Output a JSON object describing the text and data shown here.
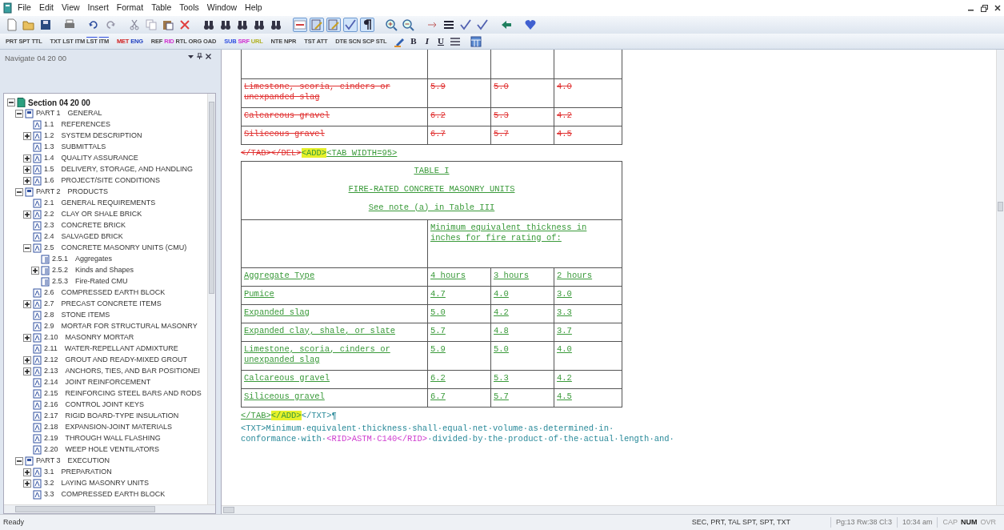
{
  "menu": [
    "File",
    "Edit",
    "View",
    "Insert",
    "Format",
    "Table",
    "Tools",
    "Window",
    "Help"
  ],
  "toolbar": [
    [
      {
        "kind": "new",
        "pressed": false
      },
      {
        "kind": "open",
        "pressed": false
      },
      {
        "kind": "save",
        "pressed": false
      }
    ],
    [
      {
        "kind": "print",
        "pressed": false
      }
    ],
    [
      {
        "kind": "undo",
        "pressed": false
      },
      {
        "kind": "redo",
        "pressed": false
      }
    ],
    [
      {
        "kind": "cut",
        "pressed": false
      },
      {
        "kind": "copy",
        "pressed": false
      },
      {
        "kind": "paste",
        "pressed": false
      },
      {
        "kind": "delete",
        "pressed": false
      }
    ],
    [
      {
        "kind": "find",
        "pressed": false
      },
      {
        "kind": "find",
        "pressed": false
      },
      {
        "kind": "find",
        "pressed": false
      },
      {
        "kind": "find",
        "pressed": false
      },
      {
        "kind": "find",
        "pressed": false
      }
    ],
    [
      {
        "kind": "tags",
        "pressed": true
      },
      {
        "kind": "view",
        "pressed": true
      },
      {
        "kind": "view",
        "pressed": true
      },
      {
        "kind": "check",
        "pressed": true
      },
      {
        "kind": "para",
        "pressed": true
      }
    ],
    [
      {
        "kind": "zoomin",
        "pressed": false
      },
      {
        "kind": "zoomout",
        "pressed": false
      }
    ],
    [
      {
        "kind": "case",
        "pressed": false
      },
      {
        "kind": "lines",
        "pressed": false
      },
      {
        "kind": "check",
        "pressed": false
      },
      {
        "kind": "check",
        "pressed": false
      }
    ],
    [
      {
        "kind": "arrow",
        "pressed": false
      }
    ],
    [
      {
        "kind": "heart",
        "pressed": false
      }
    ]
  ],
  "tag_toolbar": [
    [
      {
        "label": "PRT"
      },
      {
        "label": "SPT"
      },
      {
        "label": "TTL"
      }
    ],
    [
      {
        "label": "TXT"
      },
      {
        "label": "LST"
      },
      {
        "label": "ITM"
      },
      {
        "label": "LST",
        "marked": true
      },
      {
        "label": "ITM",
        "marked": true
      }
    ],
    [
      {
        "label": "MET",
        "color": "#d02020"
      },
      {
        "label": "ENG",
        "color": "#2040c0"
      }
    ],
    [
      {
        "label": "REF"
      },
      {
        "label": "RID",
        "color": "#d030d0"
      },
      {
        "label": "RTL"
      },
      {
        "label": "ORG"
      },
      {
        "label": "OAD"
      }
    ],
    [
      {
        "label": "SUB",
        "color": "#3050e0"
      },
      {
        "label": "SRF",
        "color": "#d030d0"
      },
      {
        "label": "URL",
        "color": "#b0b020"
      }
    ],
    [
      {
        "label": "NTE"
      },
      {
        "label": "NPR"
      }
    ],
    [
      {
        "label": "TST"
      },
      {
        "label": "ATT"
      }
    ],
    [
      {
        "label": "DTE"
      },
      {
        "label": "SCN"
      },
      {
        "label": "SCP"
      },
      {
        "label": "STL"
      }
    ]
  ],
  "format_buttons": [
    {
      "label": "B",
      "kind": "bold"
    },
    {
      "label": "I",
      "kind": "italic"
    },
    {
      "label": "U",
      "kind": "underline"
    }
  ],
  "navigator": {
    "title": "Navigate 04 20 00",
    "tree": [
      {
        "kind": "section",
        "title": "Section 04 20 00",
        "collapsible": true,
        "expanded": true,
        "children": [
          {
            "kind": "part",
            "number": "PART 1",
            "title": "GENERAL",
            "collapsible": true,
            "expanded": true,
            "children": [
              {
                "kind": "article",
                "number": "1.1",
                "title": "REFERENCES",
                "collapsible": false
              },
              {
                "kind": "article",
                "number": "1.2",
                "title": "SYSTEM DESCRIPTION",
                "collapsible": true,
                "expanded": false
              },
              {
                "kind": "article",
                "number": "1.3",
                "title": "SUBMITTALS",
                "collapsible": false
              },
              {
                "kind": "article",
                "number": "1.4",
                "title": "QUALITY ASSURANCE",
                "collapsible": true,
                "expanded": false
              },
              {
                "kind": "article",
                "number": "1.5",
                "title": "DELIVERY, STORAGE, AND HANDLING",
                "collapsible": true,
                "expanded": false
              },
              {
                "kind": "article",
                "number": "1.6",
                "title": "PROJECT/SITE CONDITIONS",
                "collapsible": true,
                "expanded": false
              }
            ]
          },
          {
            "kind": "part",
            "number": "PART 2",
            "title": "PRODUCTS",
            "collapsible": true,
            "expanded": true,
            "children": [
              {
                "kind": "article",
                "number": "2.1",
                "title": "GENERAL REQUIREMENTS",
                "collapsible": false
              },
              {
                "kind": "article",
                "number": "2.2",
                "title": "CLAY OR SHALE BRICK",
                "collapsible": true,
                "expanded": false
              },
              {
                "kind": "article",
                "number": "2.3",
                "title": "CONCRETE BRICK",
                "collapsible": false
              },
              {
                "kind": "article",
                "number": "2.4",
                "title": "SALVAGED BRICK",
                "collapsible": false
              },
              {
                "kind": "article",
                "number": "2.5",
                "title": "CONCRETE MASONRY UNITS (CMU)",
                "collapsible": true,
                "expanded": true,
                "children": [
                  {
                    "kind": "paragraph",
                    "number": "2.5.1",
                    "title": "Aggregates",
                    "collapsible": false
                  },
                  {
                    "kind": "paragraph",
                    "number": "2.5.2",
                    "title": "Kinds and Shapes",
                    "collapsible": true,
                    "expanded": false
                  },
                  {
                    "kind": "paragraph",
                    "number": "2.5.3",
                    "title": "Fire-Rated CMU",
                    "collapsible": false
                  }
                ]
              },
              {
                "kind": "article",
                "number": "2.6",
                "title": "COMPRESSED EARTH BLOCK",
                "collapsible": false
              },
              {
                "kind": "article",
                "number": "2.7",
                "title": "PRECAST CONCRETE ITEMS",
                "collapsible": true,
                "expanded": false
              },
              {
                "kind": "article",
                "number": "2.8",
                "title": "STONE ITEMS",
                "collapsible": false
              },
              {
                "kind": "article",
                "number": "2.9",
                "title": "MORTAR FOR STRUCTURAL MASONRY",
                "collapsible": false
              },
              {
                "kind": "article",
                "number": "2.10",
                "title": "MASONRY MORTAR",
                "collapsible": true,
                "expanded": false
              },
              {
                "kind": "article",
                "number": "2.11",
                "title": "WATER-REPELLANT ADMIXTURE",
                "collapsible": false
              },
              {
                "kind": "article",
                "number": "2.12",
                "title": "GROUT AND READY-MIXED GROUT",
                "collapsible": true,
                "expanded": false
              },
              {
                "kind": "article",
                "number": "2.13",
                "title": "ANCHORS, TIES, AND BAR POSITIONEI",
                "collapsible": true,
                "expanded": false
              },
              {
                "kind": "article",
                "number": "2.14",
                "title": "JOINT REINFORCEMENT",
                "collapsible": false
              },
              {
                "kind": "article",
                "number": "2.15",
                "title": "REINFORCING STEEL BARS AND RODS",
                "collapsible": false
              },
              {
                "kind": "article",
                "number": "2.16",
                "title": "CONTROL JOINT KEYS",
                "collapsible": false
              },
              {
                "kind": "article",
                "number": "2.17",
                "title": "RIGID BOARD-TYPE INSULATION",
                "collapsible": false
              },
              {
                "kind": "article",
                "number": "2.18",
                "title": "EXPANSION-JOINT MATERIALS",
                "collapsible": false
              },
              {
                "kind": "article",
                "number": "2.19",
                "title": "THROUGH WALL FLASHING",
                "collapsible": false
              },
              {
                "kind": "article",
                "number": "2.20",
                "title": "WEEP HOLE VENTILATORS",
                "collapsible": false
              }
            ]
          },
          {
            "kind": "part",
            "number": "PART 3",
            "title": "EXECUTION",
            "collapsible": true,
            "expanded": true,
            "children": [
              {
                "kind": "article",
                "number": "3.1",
                "title": "PREPARATION",
                "collapsible": true,
                "expanded": false
              },
              {
                "kind": "article",
                "number": "3.2",
                "title": "LAYING MASONRY UNITS",
                "collapsible": true,
                "expanded": false
              },
              {
                "kind": "article",
                "number": "3.3",
                "title": "COMPRESSED EARTH BLOCK",
                "collapsible": false
              }
            ]
          }
        ]
      }
    ]
  },
  "document": {
    "top_row_cut_off": true,
    "deleted_rows": [
      [
        "Limestone, scoria, cinders or unexpanded slag",
        "5.9",
        "5.0",
        "4.0"
      ],
      [
        "Calcareous gravel",
        "6.2",
        "5.3",
        "4.2"
      ],
      [
        "Siliceous gravel",
        "6.7",
        "5.7",
        "4.5"
      ]
    ],
    "tag_line": [
      {
        "kind": "deleted",
        "text": "</TAB></DEL>"
      },
      {
        "kind": "highlight",
        "text": "<ADD>"
      },
      {
        "kind": "added",
        "text": "<TAB WIDTH=95>"
      }
    ],
    "table": {
      "title_lines": [
        "TABLE I",
        "FIRE-RATED CONCRETE MASONRY UNITS",
        "See note (a) in Table III"
      ],
      "group_header": "Minimum equivalent thickness in inches for fire rating of:",
      "columns": [
        "Aggregate Type",
        "4 hours",
        "3 hours",
        "2 hours"
      ],
      "rows": [
        [
          "Pumice",
          "4.7",
          "4.0",
          "3.0"
        ],
        [
          "Expanded slag",
          "5.0",
          "4.2",
          "3.3"
        ],
        [
          "Expanded clay, shale, or slate",
          "5.7",
          "4.8",
          "3.7"
        ],
        [
          "Limestone, scoria, cinders or unexpanded slag",
          "5.9",
          "5.0",
          "4.0"
        ],
        [
          "Calcareous gravel",
          "6.2",
          "5.3",
          "4.2"
        ],
        [
          "Siliceous gravel",
          "6.7",
          "5.7",
          "4.5"
        ]
      ]
    },
    "closing_line": [
      {
        "kind": "added",
        "text": "</TAB>"
      },
      {
        "kind": "highlight",
        "text": "</ADD>"
      },
      {
        "kind": "tag",
        "text": "</TXT>¶"
      }
    ],
    "paragraph_lines": [
      [
        {
          "kind": "text",
          "text": "<TXT>Minimum·equivalent·thickness·shall·equal·net·volume·as·determined·in·"
        }
      ],
      [
        {
          "kind": "text",
          "text": "conformance·with·"
        },
        {
          "kind": "ref",
          "text": "<RID>ASTM·C140</RID>"
        },
        {
          "kind": "text",
          "text": "·divided·by·the·product·of·the·actual·length·and·"
        }
      ]
    ]
  },
  "status_bar": {
    "message": "Ready",
    "tags": "SEC, PRT, TAL SPT, SPT, TXT",
    "position": "Pg:13 Rw:38 Cl:3",
    "time": "10:34 am",
    "indicators": [
      {
        "label": "CAP",
        "on": false
      },
      {
        "label": "NUM",
        "on": true
      },
      {
        "label": "OVR",
        "on": false
      }
    ]
  }
}
